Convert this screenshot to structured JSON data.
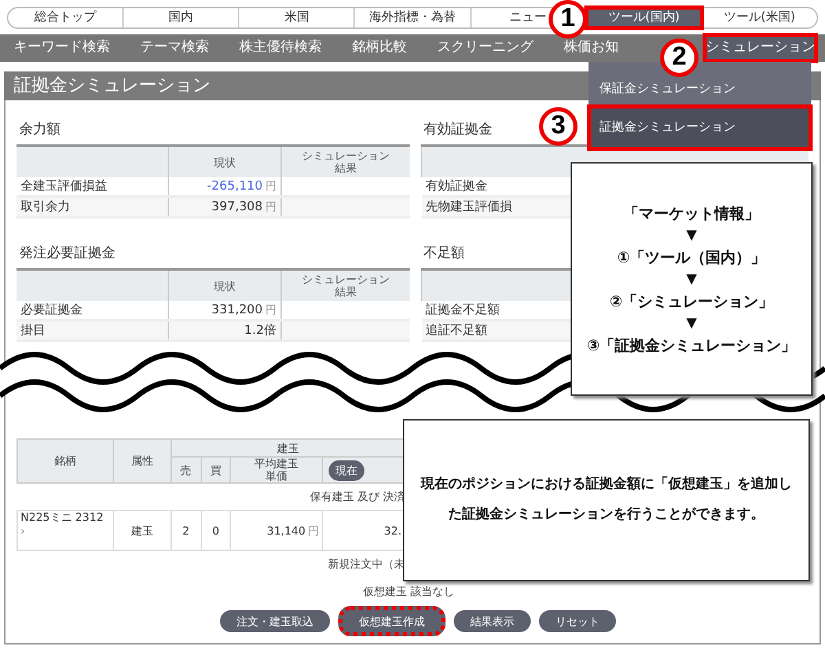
{
  "top_nav": [
    {
      "label": "総合トップ",
      "selected": false
    },
    {
      "label": "国内",
      "selected": false
    },
    {
      "label": "米国",
      "selected": false
    },
    {
      "label": "海外指標・為替",
      "selected": false
    },
    {
      "label": "ニュー",
      "selected": false
    },
    {
      "label": "ツール(国内)",
      "selected": true
    },
    {
      "label": "ツール(米国)",
      "selected": false
    }
  ],
  "sub_nav": [
    {
      "label": "キーワード検索",
      "selected": false
    },
    {
      "label": "テーマ検索",
      "selected": false
    },
    {
      "label": "株主優待検索",
      "selected": false
    },
    {
      "label": "銘柄比較",
      "selected": false
    },
    {
      "label": "スクリーニング",
      "selected": false
    },
    {
      "label": "株価お知",
      "selected": false
    },
    {
      "label": "シミュレーション",
      "selected": true
    }
  ],
  "dropdown": [
    {
      "label": "保証金シミュレーション",
      "selected": false
    },
    {
      "label": "証拠金シミュレーション",
      "selected": true
    }
  ],
  "page_title": "証拠金シミュレーション",
  "sections": [
    {
      "left": {
        "title": "余力額",
        "columns": [
          [
            "現状"
          ],
          [
            "シミュレーション",
            "結果"
          ]
        ],
        "rows": [
          {
            "label": "全建玉評価損益",
            "value": "-265,110",
            "unit": "円",
            "negative": true
          },
          {
            "label": "取引余力",
            "value": "397,308",
            "unit": "円",
            "negative": false
          }
        ]
      },
      "right": {
        "title": "有効証拠金",
        "rows": [
          "有効証拠金",
          "先物建玉評価損"
        ]
      }
    },
    {
      "left": {
        "title": "発注必要証拠金",
        "columns": [
          [
            "現状"
          ],
          [
            "シミュレーション",
            "結果"
          ]
        ],
        "rows": [
          {
            "label": "必要証拠金",
            "value": "331,200",
            "unit": "円",
            "negative": false
          },
          {
            "label": "掛目",
            "value": "1.2倍",
            "negative": false
          }
        ]
      },
      "right": {
        "title": "不足額",
        "rows": [
          "証拠金不足額",
          "追証不足額"
        ]
      }
    }
  ],
  "positions": {
    "name": "銘柄",
    "attr": "属性",
    "group": "建玉",
    "sell": "売",
    "buy": "買",
    "avg": [
      "平均建玉",
      "単価"
    ],
    "current_button": "現在",
    "held_caption": "保有建玉 及び 決済",
    "rows": [
      {
        "name": "N225ミニ 2312",
        "link": "›",
        "attr": "建玉",
        "sell": "2",
        "buy": "0",
        "avg": "31,140",
        "avg_unit": "円",
        "current": "32."
      }
    ],
    "pending_caption": "新規注文中（未",
    "virtual_caption": "仮想建玉 該当なし"
  },
  "buttons": [
    {
      "label": "注文・建玉取込",
      "highlighted": false
    },
    {
      "label": "仮想建玉作成",
      "highlighted": true
    },
    {
      "label": "結果表示",
      "highlighted": false
    },
    {
      "label": "リセット",
      "highlighted": false
    }
  ],
  "markers": [
    "1",
    "2",
    "3"
  ],
  "steps_callout": [
    {
      "kind": "step",
      "text": "「マーケット情報」"
    },
    {
      "kind": "arrow",
      "text": "▼"
    },
    {
      "kind": "step",
      "text": "①「ツール（国内）」"
    },
    {
      "kind": "arrow",
      "text": "▼"
    },
    {
      "kind": "step",
      "text": "②「シミュレーション」"
    },
    {
      "kind": "arrow",
      "text": "▼"
    },
    {
      "kind": "step",
      "text": "③「証拠金シミュレーション」"
    }
  ],
  "note_callout": "現在のポジションにおける証拠金額に「仮想建玉」を追加した証拠金シミュレーションを行うことができます。"
}
